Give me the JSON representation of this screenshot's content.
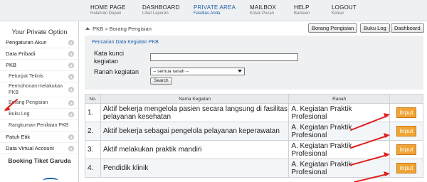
{
  "nav": [
    {
      "title": "HOME PAGE",
      "subtitle": "Halaman Depan"
    },
    {
      "title": "DASHBOARD",
      "subtitle": "Lihat Laporan"
    },
    {
      "title": "PRIVATE AREA",
      "subtitle": "Fasilitas Anda"
    },
    {
      "title": "MAILBOX",
      "subtitle": "Kotak Pesan"
    },
    {
      "title": "HELP",
      "subtitle": "Bantuan"
    },
    {
      "title": "LOGOUT",
      "subtitle": "Keluar"
    }
  ],
  "sidebar": {
    "title": "Your Private Option",
    "items": [
      {
        "label": "Pengaturan Akun"
      },
      {
        "label": "Data Pribadi"
      },
      {
        "label": "PKB"
      },
      {
        "label": "Petunjuk Teknis"
      },
      {
        "label": "Permohonan melakukan PKB"
      },
      {
        "label": "Borang Pengisian"
      },
      {
        "label": "Buku Log"
      },
      {
        "label": "Rangkuman Penilaian PKB"
      },
      {
        "label": "Patuh Etik"
      },
      {
        "label": "Data Virtual Account"
      }
    ],
    "booking": "Booking Tiket Garuda"
  },
  "breadcrumb": {
    "parent": "PKB",
    "separator": ">",
    "current": "Borang Pengisian"
  },
  "top_buttons": [
    "Borang Pengisian",
    "Buku Log",
    "Dashboard"
  ],
  "search": {
    "title": "Pencarian Data Kegiatan PKB",
    "keyword_label_1": "Kata kunci",
    "keyword_label_2": "kegiatan",
    "keyword_value": "",
    "domain_label": "Ranah kegiatan",
    "domain_selected": "-- semua ranah --",
    "button": "Search"
  },
  "table": {
    "headers": [
      "No.",
      "Nama Kegiatan",
      "Ranah",
      ""
    ],
    "rows": [
      {
        "no": "1.",
        "name": "Aktif bekerja mengelola pasien secara langsung di fasilitas pelayanan kesehatan",
        "ranah": "A. Kegiatan Praktik Profesional",
        "action": "Input"
      },
      {
        "no": "2.",
        "name": "Aktif bekerja sebagai pengelola pelayanan keperawatan",
        "ranah": "A. Kegiatan Praktik Profesional",
        "action": "Input"
      },
      {
        "no": "3.",
        "name": "Aktif melakukan praktik mandiri",
        "ranah": "A. Kegiatan Praktik Profesional",
        "action": "Input"
      },
      {
        "no": "4.",
        "name": "Pendidik klinik",
        "ranah": "A. Kegiatan Praktik Profesional",
        "action": "Input"
      }
    ]
  },
  "colors": {
    "accent": "#1f5fa8",
    "input_button": "#f0a433",
    "annotation_arrow": "#e02020"
  }
}
